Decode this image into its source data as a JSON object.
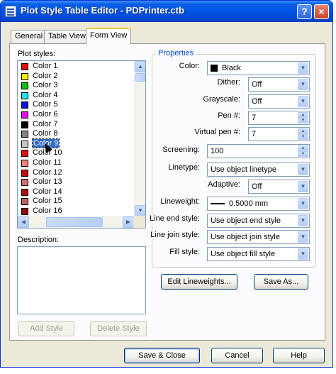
{
  "window": {
    "title": "Plot Style Table Editor - PDPrinter.ctb",
    "help_btn": "?",
    "close_btn": "×"
  },
  "tabs": [
    {
      "label": "General",
      "active": false
    },
    {
      "label": "Table View",
      "active": false
    },
    {
      "label": "Form View",
      "active": true
    }
  ],
  "plot_styles": {
    "label": "Plot styles:",
    "selected": "Color 9",
    "items": [
      {
        "label": "Color 1",
        "color": "#e01010"
      },
      {
        "label": "Color 2",
        "color": "#f5f000"
      },
      {
        "label": "Color 3",
        "color": "#10c010"
      },
      {
        "label": "Color 4",
        "color": "#20e0e8"
      },
      {
        "label": "Color 5",
        "color": "#1010e0"
      },
      {
        "label": "Color 6",
        "color": "#e010e0"
      },
      {
        "label": "Color 7",
        "color": "#000000"
      },
      {
        "label": "Color 8",
        "color": "#808080"
      },
      {
        "label": "Color 9",
        "color": "#c8c8c8"
      },
      {
        "label": "Color 10",
        "color": "#e01010"
      },
      {
        "label": "Color 11",
        "color": "#f08080"
      },
      {
        "label": "Color 12",
        "color": "#c01010"
      },
      {
        "label": "Color 13",
        "color": "#d07070"
      },
      {
        "label": "Color 14",
        "color": "#b01010"
      },
      {
        "label": "Color 15",
        "color": "#c06060"
      },
      {
        "label": "Color 16",
        "color": "#900808"
      }
    ]
  },
  "description": {
    "label": "Description:",
    "value": ""
  },
  "buttons": {
    "add_style": "Add Style",
    "delete_style": "Delete Style",
    "edit_lineweights": "Edit Lineweights...",
    "save_as": "Save As...",
    "save_close": "Save & Close",
    "cancel": "Cancel",
    "help": "Help"
  },
  "properties": {
    "title": "Properties",
    "color": {
      "label": "Color:",
      "value": "Black"
    },
    "dither": {
      "label": "Dither:",
      "value": "Off"
    },
    "grayscale": {
      "label": "Grayscale:",
      "value": "Off"
    },
    "pen": {
      "label": "Pen #:",
      "value": "7"
    },
    "virtual_pen": {
      "label": "Virtual pen #:",
      "value": "7"
    },
    "screening": {
      "label": "Screening:",
      "value": "100"
    },
    "linetype": {
      "label": "Linetype:",
      "value": "Use object linetype"
    },
    "adaptive": {
      "label": "Adaptive:",
      "value": "Off"
    },
    "lineweight": {
      "label": "Lineweight:",
      "value": "0.5000 mm"
    },
    "line_end": {
      "label": "Line end style:",
      "value": "Use object end style"
    },
    "line_join": {
      "label": "Line join style:",
      "value": "Use object join style"
    },
    "fill": {
      "label": "Fill style:",
      "value": "Use object fill style"
    }
  }
}
